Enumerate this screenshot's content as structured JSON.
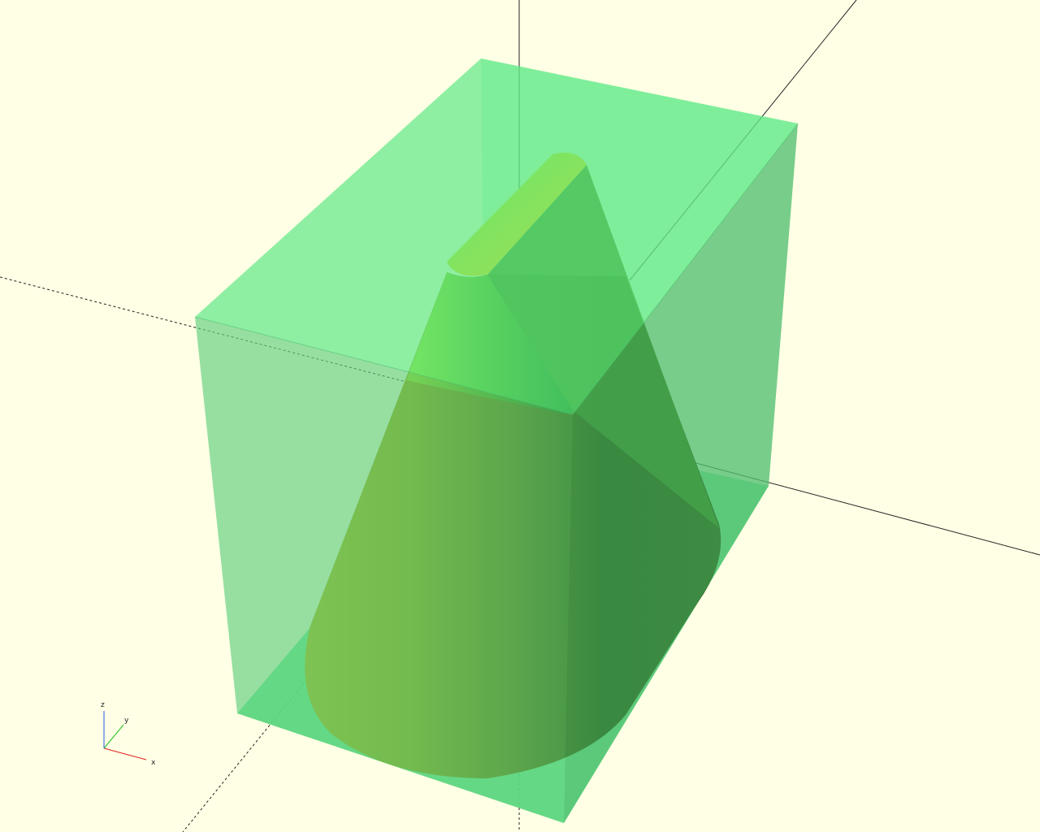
{
  "viewport": {
    "background": "#ffffe5"
  },
  "colors": {
    "box_top": "#5ee986",
    "box_front": "#5bc078",
    "box_right": "#5ac07a",
    "cone_highlight": "#8fe23c",
    "cone_dark": "#2a6a1e",
    "cut_face": "#3d9a2e",
    "top_cap": "#96e23a",
    "axis_x": "#e02020",
    "axis_y": "#20c020",
    "axis_z": "#2060e0"
  },
  "axes_indicator": {
    "x_label": "x",
    "y_label": "y",
    "z_label": "z"
  }
}
